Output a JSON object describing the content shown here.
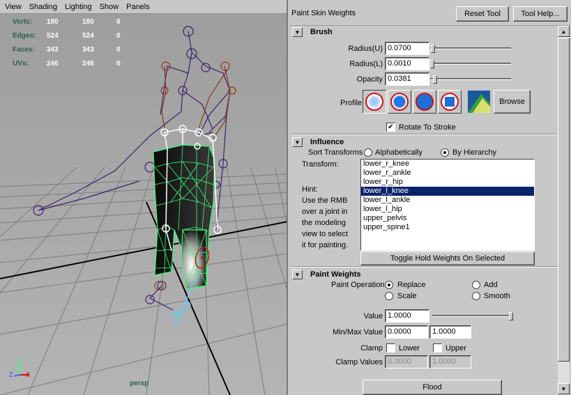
{
  "viewport": {
    "menu": [
      "View",
      "Shading",
      "Lighting",
      "Show",
      "Panels"
    ],
    "hud": [
      {
        "label": "Verts:",
        "v1": "180",
        "v2": "180",
        "v3": "0"
      },
      {
        "label": "Edges:",
        "v1": "524",
        "v2": "524",
        "v3": "0"
      },
      {
        "label": "Faces:",
        "v1": "343",
        "v2": "343",
        "v3": "0"
      },
      {
        "label": "UVs:",
        "v1": "246",
        "v2": "246",
        "v3": "0"
      }
    ],
    "camera": "persp",
    "axis_labels": {
      "y": "Y",
      "x": "X",
      "z": "Z"
    },
    "colors": {
      "mesh": "#3cff78",
      "joint_sel": "#ffffff",
      "joint": "#3a1f6a",
      "joint_alt": "#8a3a1a",
      "weight_hot": "#ffffff",
      "brush": "#cc1111"
    }
  },
  "panel": {
    "title": "Paint Skin Weights",
    "reset_tool": "Reset Tool",
    "tool_help": "Tool Help...",
    "brush": {
      "title": "Brush",
      "radius_u_label": "Radius(U)",
      "radius_u": "0.0700",
      "radius_l_label": "Radius(L)",
      "radius_l": "0.0010",
      "opacity_label": "Opacity",
      "opacity": "0.0381",
      "profile_label": "Profile",
      "profiles": [
        "gaussian-brush-icon",
        "soft-brush-icon",
        "solid-brush-icon",
        "square-brush-icon"
      ],
      "browse": "Browse",
      "rotate_label": "Rotate To Stroke",
      "rotate_checked": true
    },
    "influence": {
      "title": "Influence",
      "sort_label": "Sort Transforms",
      "sort_alpha": "Alphabetically",
      "sort_hier": "By Hierarchy",
      "sort_selected": "By Hierarchy",
      "transform_label": "Transform:",
      "hint_lines": [
        "Hint:",
        "Use the RMB",
        "over a joint in",
        "the modeling",
        "view to select",
        "it for painting."
      ],
      "items": [
        "lower_r_knee",
        "lower_r_ankle",
        "lower_r_hip",
        "lower_l_knee",
        "lower_l_ankle",
        "lower_l_hip",
        "upper_pelvis",
        "upper_spine1"
      ],
      "selected": "lower_l_knee",
      "toggle_btn": "Toggle Hold Weights On Selected"
    },
    "paint_weights": {
      "title": "Paint Weights",
      "op_label": "Paint Operation",
      "op_replace": "Replace",
      "op_add": "Add",
      "op_scale": "Scale",
      "op_smooth": "Smooth",
      "op_selected": "Replace",
      "value_label": "Value",
      "value": "1.0000",
      "value_level": 1.0,
      "minmax_label": "Min/Max Value",
      "min": "0.0000",
      "max": "1.0000",
      "clamp_label": "Clamp",
      "clamp_lower": "Lower",
      "clamp_upper": "Upper",
      "clamp_values_label": "Clamp Values",
      "clamp_min": "0.0000",
      "clamp_max": "1.0000",
      "flood": "Flood"
    },
    "colors": {
      "selection": "#0a246a",
      "panel_bg": "#c8c8c8",
      "profile_blue": "#1e6fd9",
      "profile_ring": "#cc1111"
    }
  }
}
